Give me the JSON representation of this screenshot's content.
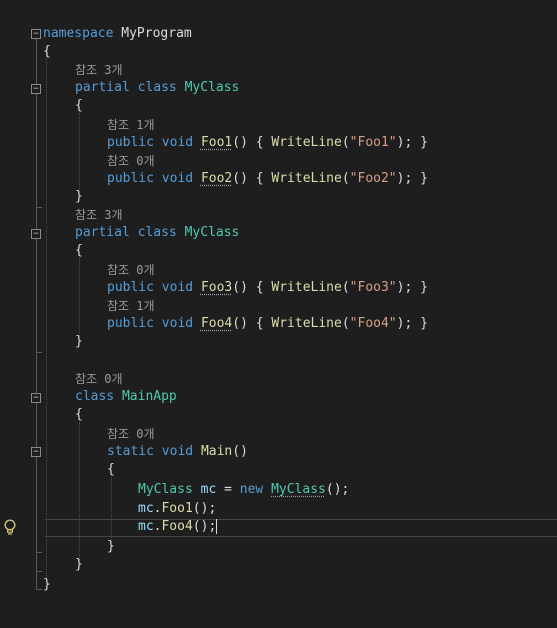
{
  "lens": {
    "myclass_1": "참조 3개",
    "foo1": "참조 1개",
    "foo2": "참조 0개",
    "myclass_2": "참조 3개",
    "foo3": "참조 0개",
    "foo4": "참조 1개",
    "mainapp": "참조 0개",
    "main": "참조 0개"
  },
  "code": {
    "kw_namespace": "namespace",
    "namespace_name": "MyProgram",
    "open_brace": "{",
    "close_brace": "}",
    "kw_partial": "partial",
    "kw_class": "class",
    "kw_public": "public",
    "kw_void": "void",
    "kw_static": "static",
    "kw_new": "new",
    "class_myclass": "MyClass",
    "class_mainapp": "MainApp",
    "method_foo1": "Foo1",
    "method_foo2": "Foo2",
    "method_foo3": "Foo3",
    "method_foo4": "Foo4",
    "method_main": "Main",
    "method_writeline": "WriteLine",
    "parens": "()",
    "body_open": " { ",
    "body_close": "; }",
    "paren_open": "(",
    "paren_close": ")",
    "str_foo1": "\"Foo1\"",
    "str_foo2": "\"Foo2\"",
    "str_foo3": "\"Foo3\"",
    "str_foo4": "\"Foo4\"",
    "var_mc": "mc",
    "assign": " = ",
    "call_end": "();",
    "dot": ".",
    "semicolon": ";",
    "fold_symbol": "−"
  },
  "colors": {
    "background": "#1e1e1e",
    "keyword": "#569cd6",
    "type": "#4ec9b0",
    "method": "#dcdcaa",
    "string": "#d69d85",
    "variable": "#9cdcfe",
    "codelens": "#999999"
  },
  "icons": {
    "lightbulb": "lightbulb-icon",
    "collapse": "collapse-icon"
  }
}
